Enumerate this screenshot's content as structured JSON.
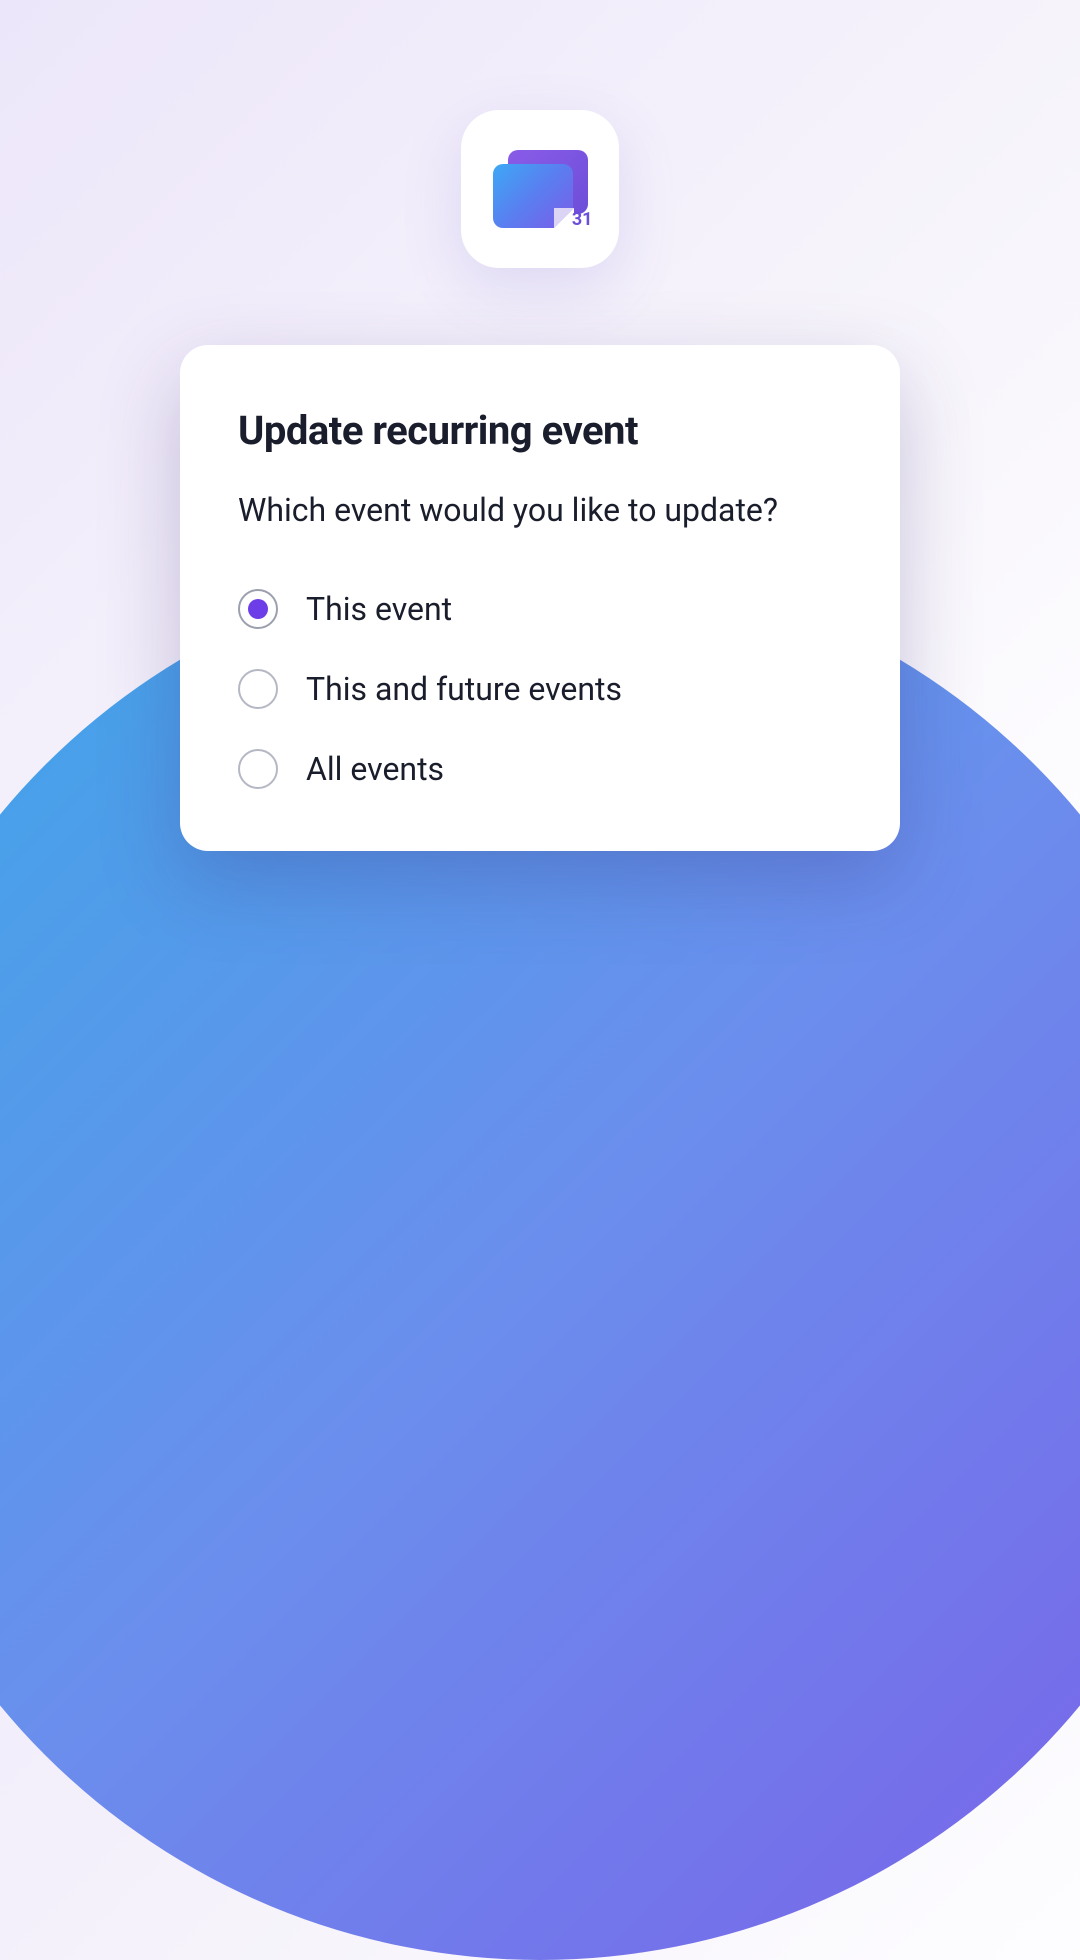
{
  "app_icon": {
    "date_number": "31"
  },
  "dialog": {
    "title": "Update recurring event",
    "subtitle": "Which event would you like to update?",
    "options": [
      {
        "label": "This event",
        "selected": true
      },
      {
        "label": "This and future events",
        "selected": false
      },
      {
        "label": "All events",
        "selected": false
      }
    ]
  },
  "colors": {
    "accent": "#6d3de8",
    "text": "#1a1d2b"
  }
}
